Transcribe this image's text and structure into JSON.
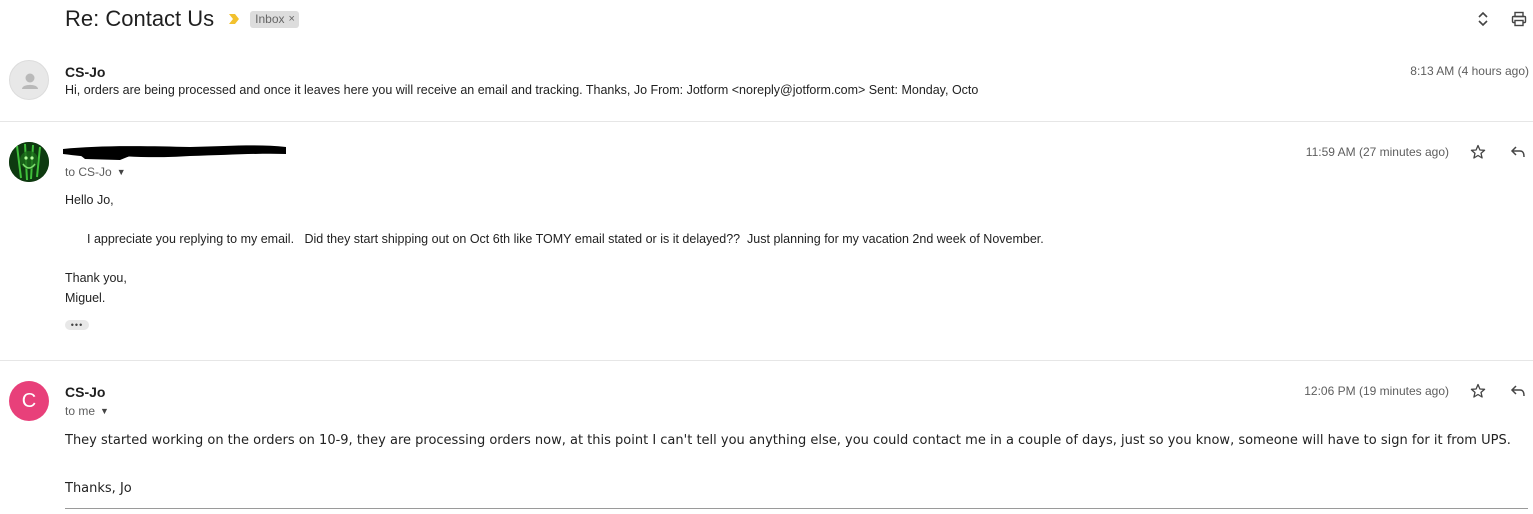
{
  "thread": {
    "subject": "Re: Contact Us",
    "label": "Inbox",
    "label_remove": "×",
    "importance_color": "#f2c12e"
  },
  "top_actions": [
    {
      "icon": "expand-collapse-icon"
    },
    {
      "icon": "print-icon"
    }
  ],
  "messages": [
    {
      "sender": "CS-Jo",
      "time": "8:13 AM (4 hours ago)",
      "snippet": "Hi, orders are being processed and once it leaves here you will receive an email and tracking. Thanks, Jo From: Jotform <noreply@jotform.com> Sent: Monday, Octo",
      "avatar": "default-person-avatar",
      "collapsed": true
    },
    {
      "sender_redacted": true,
      "recipient": "to CS-Jo",
      "time": "11:59 AM (27 minutes ago)",
      "body": {
        "greeting": "Hello Jo,",
        "paragraph": "I appreciate you replying to my email.   Did they start shipping out on Oct 6th like TOMY email stated or is it delayed??  Just planning for my vacation 2nd week of November.",
        "closing": "Thank you,",
        "signature": "Miguel."
      },
      "avatar": "green-photo-avatar",
      "show_trimmed": "•••"
    },
    {
      "sender": "CS-Jo",
      "avatar_letter": "C",
      "avatar_color": "#e8407a",
      "recipient": "to me",
      "time": "12:06 PM (19 minutes ago)",
      "body": {
        "paragraph": "They started working on the orders on 10-9, they are processing orders now, at this point I can't tell you anything else, you could contact me in a couple of days, just so you know, someone will have to sign for it from UPS.",
        "signoff": "Thanks, Jo"
      }
    }
  ]
}
